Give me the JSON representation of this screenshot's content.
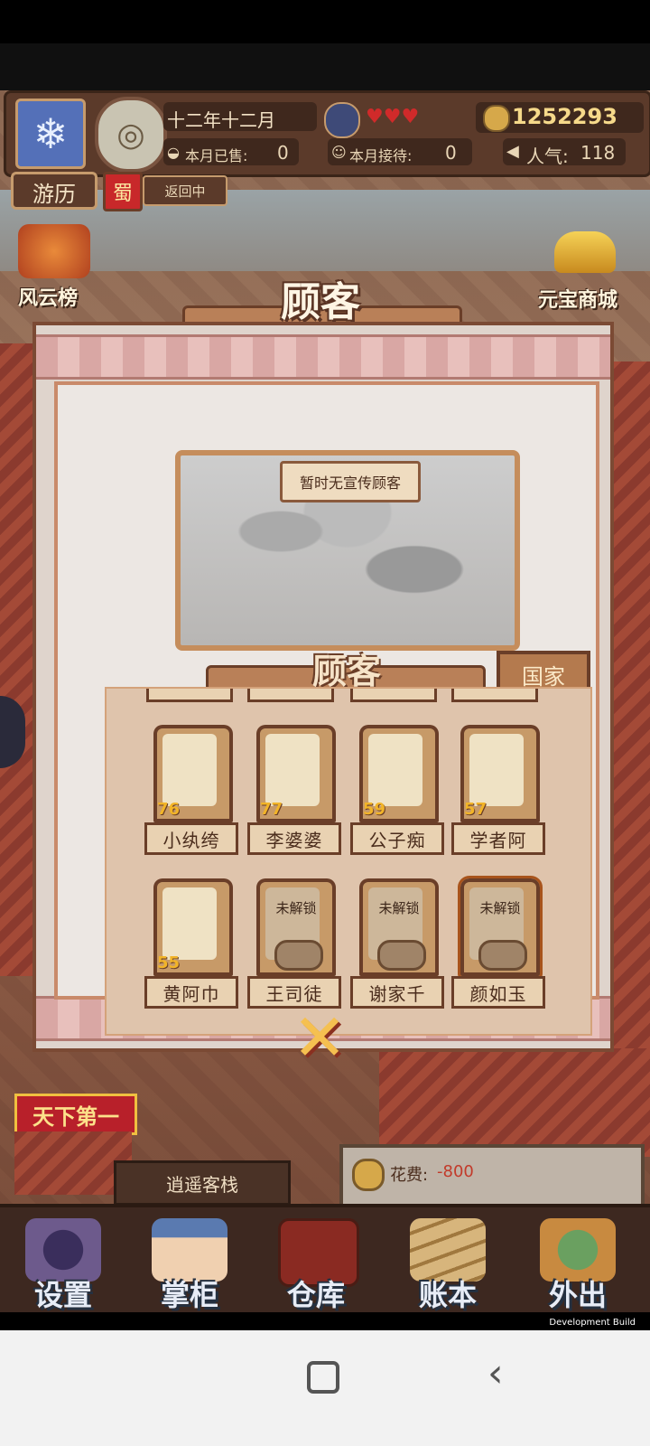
{
  "hud": {
    "season_icon": "snowflake-icon",
    "date": "十二年十二月",
    "coins": "1252293",
    "sold_label": "本月已售:",
    "sold_value": "0",
    "served_label": "本月接待:",
    "served_value": "0",
    "popularity_label": "人气:",
    "popularity_value": "118",
    "hearts": "♥♥♥"
  },
  "left_tabs": {
    "travel": "游历",
    "region": "蜀",
    "status": "返回中",
    "ranking": "风云榜"
  },
  "right_tabs": {
    "shop": "元宝商城"
  },
  "modal": {
    "title": "顾客",
    "promo_label": "暂时无宣传顾客",
    "section_title": "顾客",
    "country_button": "国家",
    "customers": [
      {
        "name": "小纨绔",
        "level": "76",
        "locked": false
      },
      {
        "name": "李婆婆",
        "level": "77",
        "locked": false
      },
      {
        "name": "公子痴",
        "level": "59",
        "locked": false
      },
      {
        "name": "学者阿",
        "level": "57",
        "locked": false
      },
      {
        "name": "黄阿巾",
        "level": "55",
        "locked": false
      },
      {
        "name": "王司徒",
        "level": "",
        "locked": true
      },
      {
        "name": "谢家千",
        "level": "",
        "locked": true
      },
      {
        "name": "颜如玉",
        "level": "",
        "locked": true
      }
    ],
    "locked_text": "未解锁"
  },
  "scene": {
    "badge": "天下第一",
    "inn_name": "逍遥客栈",
    "cost_label": "花费:",
    "cost_value": "-800"
  },
  "menu": [
    {
      "label": "设置",
      "icon": "yin-yang-gear-icon"
    },
    {
      "label": "掌柜",
      "icon": "shopkeeper-icon"
    },
    {
      "label": "仓库",
      "icon": "chest-icon"
    },
    {
      "label": "账本",
      "icon": "scrolls-icon"
    },
    {
      "label": "外出",
      "icon": "travel-bag-icon"
    }
  ],
  "dev_build": "Development Build",
  "colors": {
    "accent_gold": "#f2b428",
    "frame_brown": "#6a3e28",
    "cost_red": "#c23a2a"
  }
}
